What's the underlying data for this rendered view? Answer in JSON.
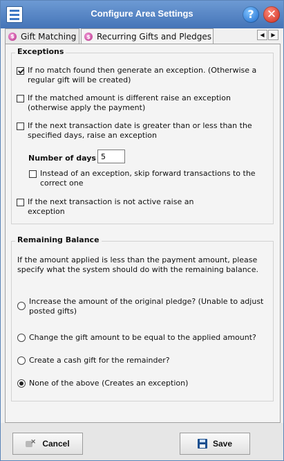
{
  "window": {
    "title": "Configure Area Settings"
  },
  "tabs": [
    {
      "label": "Gift Matching",
      "active": false
    },
    {
      "label": "Recurring Gifts and Pledges",
      "active": true
    }
  ],
  "exceptions": {
    "heading": "Exceptions",
    "no_match": {
      "label": "If no match found then generate an exception. (Otherwise a regular gift will be created)",
      "checked": true
    },
    "amount_different": {
      "label": "If the matched amount is different raise an exception (otherwise apply the payment)",
      "checked": false
    },
    "next_date": {
      "label": "If the next transaction date is greater than or less than the specified days, raise an exception",
      "checked": false
    },
    "number_of_days": {
      "label": "Number of days",
      "value": "5"
    },
    "skip_forward": {
      "label": "Instead of an exception, skip forward transactions to the correct one",
      "checked": false
    },
    "not_active": {
      "label": "If the next transaction is not active raise an exception",
      "checked": false
    }
  },
  "remaining_balance": {
    "heading": "Remaining Balance",
    "description": "If the amount applied is less than the payment amount, please specify what the system should do with the remaining balance.",
    "options": [
      {
        "label": "Increase the amount of the original pledge? (Unable to adjust posted gifts)",
        "selected": false
      },
      {
        "label": "Change the gift amount to be equal to the applied amount?",
        "selected": false
      },
      {
        "label": "Create a cash gift for the remainder?",
        "selected": false
      },
      {
        "label": "None of the above (Creates an exception)",
        "selected": true
      }
    ]
  },
  "footer": {
    "cancel_label": "Cancel",
    "save_label": "Save"
  },
  "icons": {
    "app": "settings-list-icon",
    "help": "help-icon",
    "close": "close-icon",
    "tab": "pledge-icon",
    "cancel": "cancel-icon",
    "save": "save-disk-icon"
  },
  "colors": {
    "titlebar": "#5585c6",
    "background": "#f0f0f0"
  }
}
